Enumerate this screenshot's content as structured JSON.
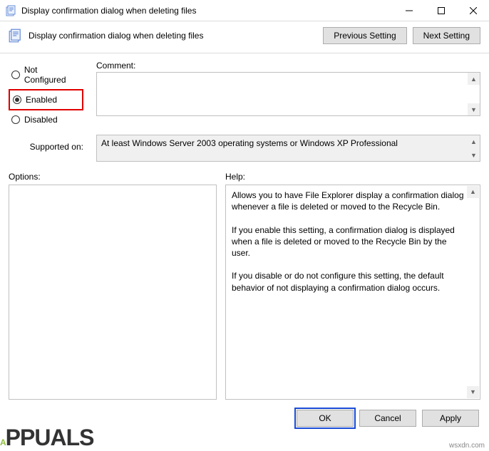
{
  "window": {
    "title": "Display confirmation dialog when deleting files"
  },
  "header": {
    "name": "Display confirmation dialog when deleting files",
    "prev": "Previous Setting",
    "next": "Next Setting"
  },
  "states": {
    "not_configured": "Not Configured",
    "enabled": "Enabled",
    "disabled": "Disabled",
    "selected": "enabled"
  },
  "labels": {
    "comment": "Comment:",
    "supported_on": "Supported on:",
    "options": "Options:",
    "help": "Help:"
  },
  "supported_on": "At least Windows Server 2003 operating systems or Windows XP Professional",
  "help": {
    "p1": "Allows you to have File Explorer display a confirmation dialog whenever a file is deleted or moved to the Recycle Bin.",
    "p2": "If you enable this setting, a confirmation dialog is displayed when a file is deleted or moved to the Recycle Bin by the user.",
    "p3": "If you disable or do not configure this setting, the default behavior of not displaying a confirmation dialog occurs."
  },
  "footer": {
    "ok": "OK",
    "cancel": "Cancel",
    "apply": "Apply"
  },
  "watermark": "wsxdn.com"
}
